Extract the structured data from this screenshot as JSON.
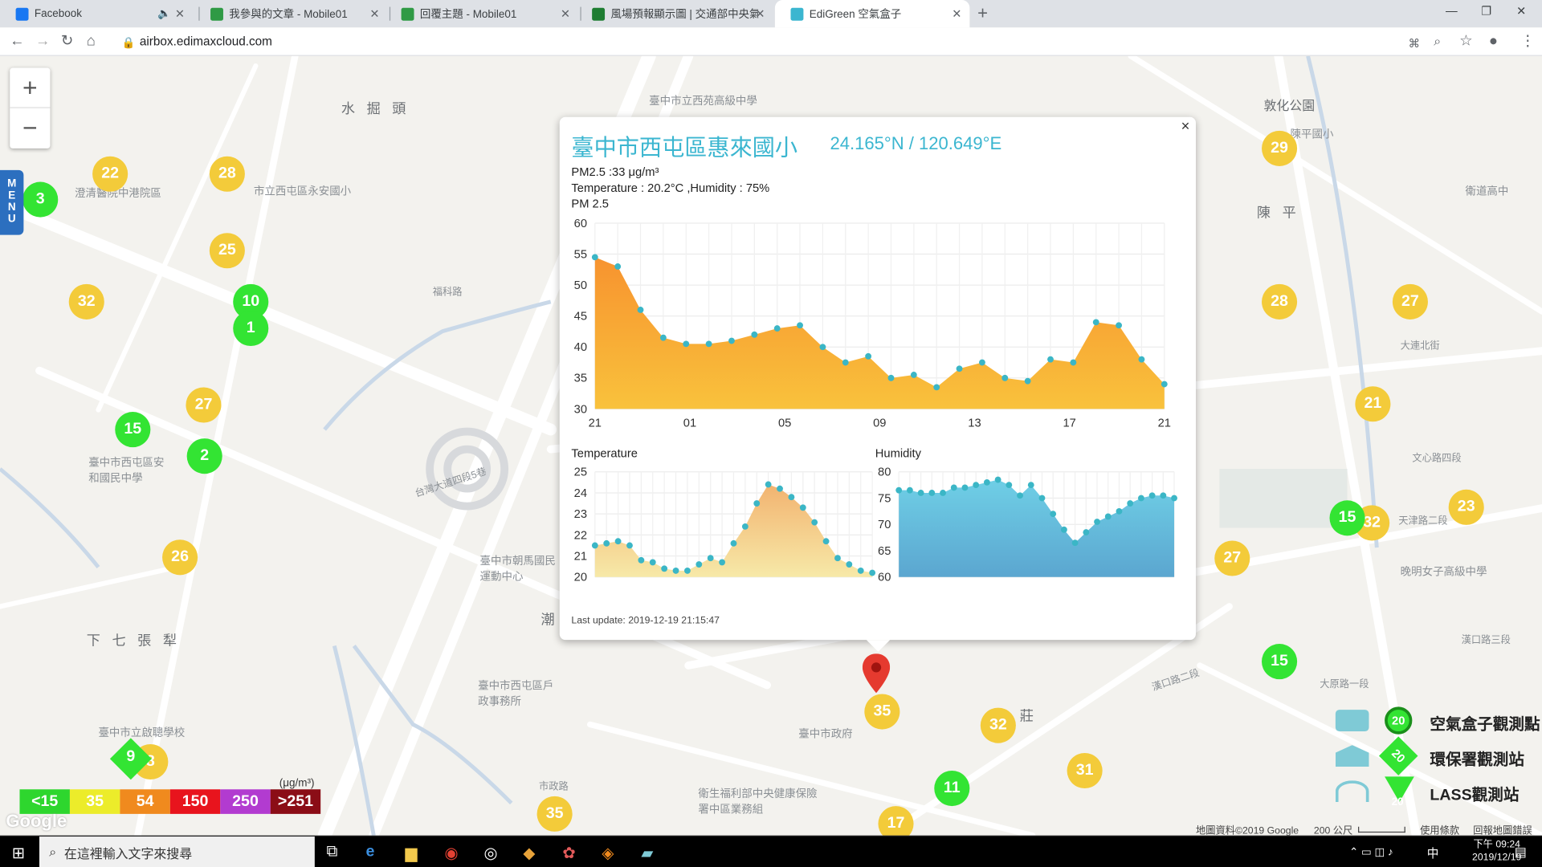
{
  "browser": {
    "tabs": [
      {
        "title": "Facebook",
        "color": "#1877f2"
      },
      {
        "title": "我參與的文章 - Mobile01",
        "color": "#2f9a45"
      },
      {
        "title": "回覆主題 - Mobile01",
        "color": "#2f9a45"
      },
      {
        "title": "風場預報顯示圖 | 交通部中央氣象",
        "color": "#1e7d32"
      },
      {
        "title": "EdiGreen 空氣盒子",
        "color": "#3bb6d0"
      }
    ],
    "url": "airbox.edimaxcloud.com"
  },
  "map": {
    "labels": [
      "水 掘 頭",
      "敦化公園",
      "陳 平",
      "下 七 張 犁",
      "臺中市西屯區安和國民中學",
      "臺中市朝馬國民運動中心",
      "臺中市立啟聰學校",
      "臺中市西屯區戶政事務所",
      "臺中市政府",
      "衛生福利部中央健康保險署中區業務組",
      "晚明女子高級中學",
      "福科路",
      "市政路",
      "台灣大道四段5巷",
      "漢口路三段",
      "天津路二段",
      "文心路四段",
      "大連北街",
      "陳平國小",
      "莊",
      "潮",
      "臺中市立西苑高級中學",
      "衛道高中",
      "市立西屯區永安國小",
      "澄清醫院中港院區",
      "漢口路二段",
      "大原路一段"
    ],
    "markers": [
      {
        "v": "22",
        "c": "y"
      },
      {
        "v": "28",
        "c": "y"
      },
      {
        "v": "3",
        "c": "g"
      },
      {
        "v": "25",
        "c": "y"
      },
      {
        "v": "32",
        "c": "y"
      },
      {
        "v": "10",
        "c": "g"
      },
      {
        "v": "1",
        "c": "g"
      },
      {
        "v": "27",
        "c": "y"
      },
      {
        "v": "15",
        "c": "g"
      },
      {
        "v": "2",
        "c": "g"
      },
      {
        "v": "26",
        "c": "y"
      },
      {
        "v": "29",
        "c": "y"
      },
      {
        "v": "28",
        "c": "y"
      },
      {
        "v": "27",
        "c": "y"
      },
      {
        "v": "21",
        "c": "y"
      },
      {
        "v": "23",
        "c": "y"
      },
      {
        "v": "32",
        "c": "y"
      },
      {
        "v": "15",
        "c": "g"
      },
      {
        "v": "27",
        "c": "y"
      },
      {
        "v": "15",
        "c": "g"
      },
      {
        "v": "32",
        "c": "y"
      },
      {
        "v": "31",
        "c": "y"
      },
      {
        "v": "11",
        "c": "g"
      },
      {
        "v": "35",
        "c": "y"
      },
      {
        "v": "35",
        "c": "y"
      },
      {
        "v": "17",
        "c": "y"
      },
      {
        "v": "8",
        "c": "y"
      }
    ],
    "diamond_value": "9",
    "menu_label": "MENU",
    "zoom_in": "+",
    "zoom_out": "−",
    "scale_items": [
      {
        "label": "<15",
        "color": "#2ed62e"
      },
      {
        "label": "35",
        "color": "#ecec2a"
      },
      {
        "label": "54",
        "color": "#f08a1e"
      },
      {
        "label": "150",
        "color": "#e8141d"
      },
      {
        "label": "250",
        "color": "#b23bd0"
      },
      {
        "label": ">251",
        "color": "#8b0d16"
      }
    ],
    "scale_unit": "(μg/m³)",
    "google": "Google",
    "attribution": "地圖資料©2019 Google",
    "scale_bar": "200 公尺",
    "terms": "使用條款",
    "report": "回報地圖錯誤",
    "legend": [
      {
        "label": "空氣盒子觀測點",
        "num": "20"
      },
      {
        "label": "環保署觀測站",
        "num": "20"
      },
      {
        "label": "LASS觀測站",
        "num": "20"
      }
    ]
  },
  "popup": {
    "title": "臺中市西屯區惠來國小",
    "coords": "24.165°N / 120.649°E",
    "pm_line": "PM2.5 :33 μg/m³",
    "th_line": "Temperature : 20.2°C ,Humidity : 75%",
    "chart_heading": "PM 2.5",
    "temp_heading": "Temperature",
    "hum_heading": "Humidity",
    "last_update": "Last update: 2019-12-19 21:15:47",
    "close": "×"
  },
  "chart_data": [
    {
      "type": "area",
      "title": "PM 2.5",
      "x_ticks": [
        "21",
        "01",
        "05",
        "09",
        "13",
        "17",
        "21"
      ],
      "ylim": [
        30,
        60
      ],
      "y_ticks": [
        30,
        35,
        40,
        45,
        50,
        55,
        60
      ],
      "values": [
        54.5,
        53,
        46,
        41.5,
        40.5,
        40.5,
        41,
        42,
        43,
        43.5,
        40,
        37.5,
        38.5,
        35,
        35.5,
        33.5,
        36.5,
        37.5,
        35,
        34.5,
        38,
        37.5,
        44,
        43.5,
        38,
        34
      ],
      "grid": true
    },
    {
      "type": "area",
      "title": "Temperature",
      "ylim": [
        20,
        25
      ],
      "y_ticks": [
        20,
        21,
        22,
        23,
        24,
        25
      ],
      "values": [
        21.5,
        21.6,
        21.7,
        21.5,
        20.8,
        20.7,
        20.4,
        20.3,
        20.3,
        20.6,
        20.9,
        20.7,
        21.6,
        22.4,
        23.5,
        24.4,
        24.2,
        23.8,
        23.3,
        22.6,
        21.7,
        20.9,
        20.6,
        20.3,
        20.2
      ],
      "grid": true
    },
    {
      "type": "area",
      "title": "Humidity",
      "ylim": [
        60,
        80
      ],
      "y_ticks": [
        60,
        65,
        70,
        75,
        80
      ],
      "values": [
        76.5,
        76.5,
        76,
        76,
        76,
        77,
        77,
        77.5,
        78,
        78.5,
        77.5,
        75.5,
        77.5,
        75,
        72,
        69,
        66.5,
        68.5,
        70.5,
        71.5,
        72.5,
        74,
        75,
        75.5,
        75.5,
        75
      ],
      "grid": true
    }
  ],
  "taskbar": {
    "search_placeholder": "在這裡輸入文字來搜尋",
    "time": "下午 09:24",
    "date": "2019/12/19",
    "ime": "中"
  }
}
